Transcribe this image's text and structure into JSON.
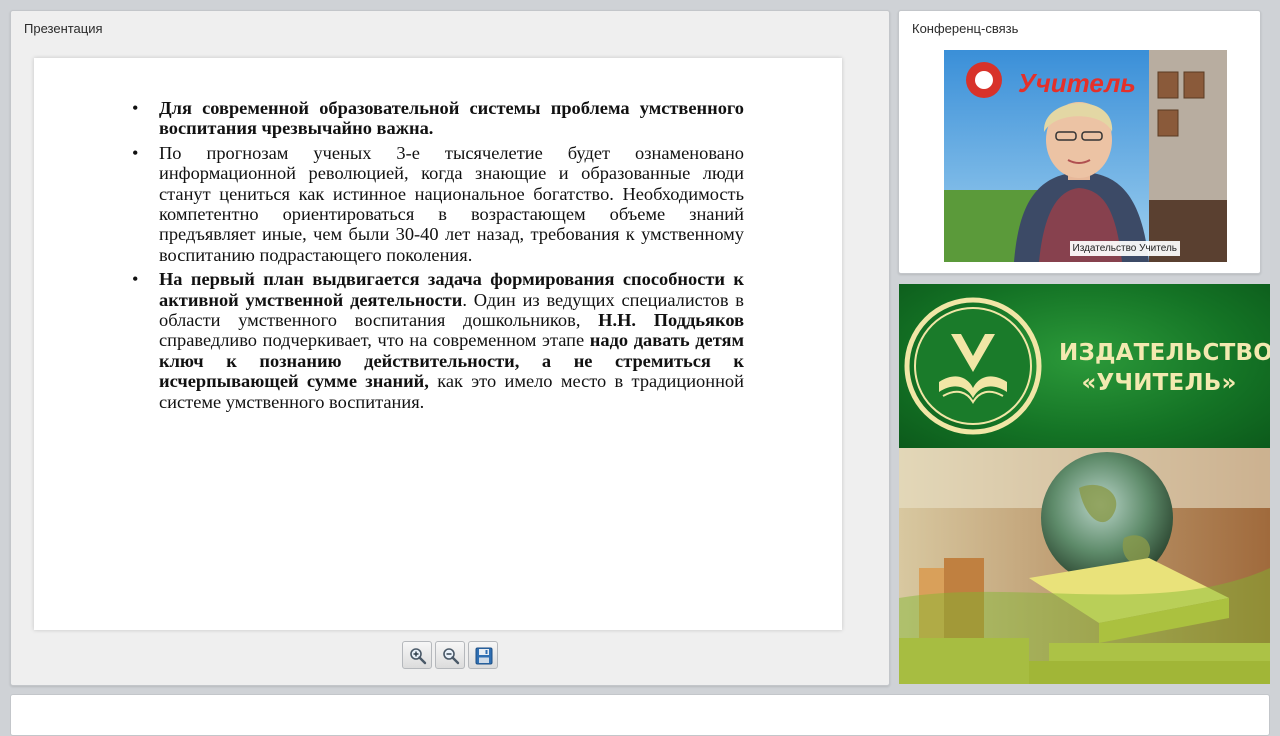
{
  "presentation_panel": {
    "title": "Презентация",
    "slide": {
      "bullets": [
        {
          "segments": [
            {
              "text": "Для современной образовательной системы проблема умственного воспитания чрезвычайно важна.",
              "bold": true
            }
          ]
        },
        {
          "segments": [
            {
              "text": "По прогнозам ученых 3-е тысячелетие будет ознаменовано информационной революцией, когда знающие и образованные люди станут цениться как истинное национальное богатство. Необходимость компетентно ориентироваться в возрастающем объеме знаний предъявляет иные, чем были 30-40 лет назад, требования к умственному воспитанию подрастающего поколения.",
              "bold": false
            }
          ]
        },
        {
          "segments": [
            {
              "text": "На первый план выдвигается задача формирования способности к активной умственной деятельности",
              "bold": true
            },
            {
              "text": ". Один из ведущих специалистов в области умственного воспитания дошкольников, ",
              "bold": false
            },
            {
              "text": "Н.Н. Поддьяков",
              "bold": true
            },
            {
              "text": " справедливо подчеркивает, что на современном этапе ",
              "bold": false
            },
            {
              "text": "надо давать детям ключ к познанию действительности, а не стремиться к исчерпывающей сумме знаний,",
              "bold": true
            },
            {
              "text": " как это имело место в традиционной системе умственного воспитания.",
              "bold": false
            }
          ]
        }
      ],
      "bullet_glyph": "•"
    },
    "toolbar": {
      "zoom_in_icon": "zoom-in-icon",
      "zoom_out_icon": "zoom-out-icon",
      "save_icon": "floppy-disk-icon"
    }
  },
  "conference_panel": {
    "title": "Конференц-связь",
    "video_caption": "Издательство Учитель",
    "video_backdrop_text": "Учитель"
  },
  "banner": {
    "publisher_name_line1": "ИЗДАТЕЛЬСТВО",
    "publisher_name_line2": "«УЧИТЕЛЬ»",
    "colors": {
      "green": "#147325",
      "gold": "#f3e9b0"
    }
  }
}
